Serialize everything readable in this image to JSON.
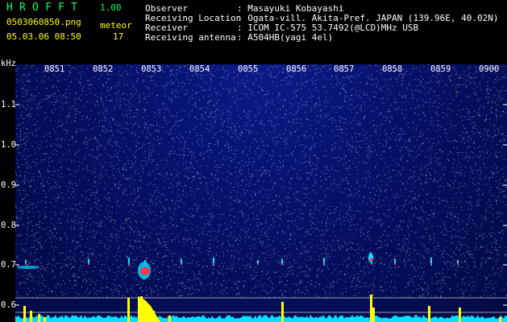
{
  "app": {
    "name": "HROFFT",
    "version": "1.00"
  },
  "file": {
    "filename": "0503060850.png",
    "datetime": "05.03.06 08:50"
  },
  "meteor": {
    "label": "meteor",
    "count": "17"
  },
  "station_info": [
    {
      "label": "Observer",
      "value": ": Masayuki Kobayashi"
    },
    {
      "label": "Receiving Location",
      "value": ": Ogata-vill. Akita-Pref. JAPAN (139.96E, 40.02N)"
    },
    {
      "label": "Receiver",
      "value": ": ICOM IC-575 53.7492(@LCD)MHz USB"
    },
    {
      "label": "Receiving antenna",
      "value": ": A504HB(yagi 4el)"
    }
  ],
  "spectrogram": {
    "freq_unit": "kHz",
    "freq_ticks": [
      "1.1",
      "1.0",
      "0.9",
      "0.8",
      "0.7",
      "0.6"
    ],
    "time_ticks": [
      "0851",
      "0852",
      "0853",
      "0854",
      "0855",
      "0856",
      "0857",
      "0858",
      "0859",
      "0900"
    ],
    "colors": {
      "background": "#061066",
      "noise": "#ffffff",
      "tick": "#ffffff",
      "echo": "#ff3355",
      "trace": "#00e0ff",
      "count_bar": "#ffff00",
      "baseline": "#9999aa"
    }
  }
}
